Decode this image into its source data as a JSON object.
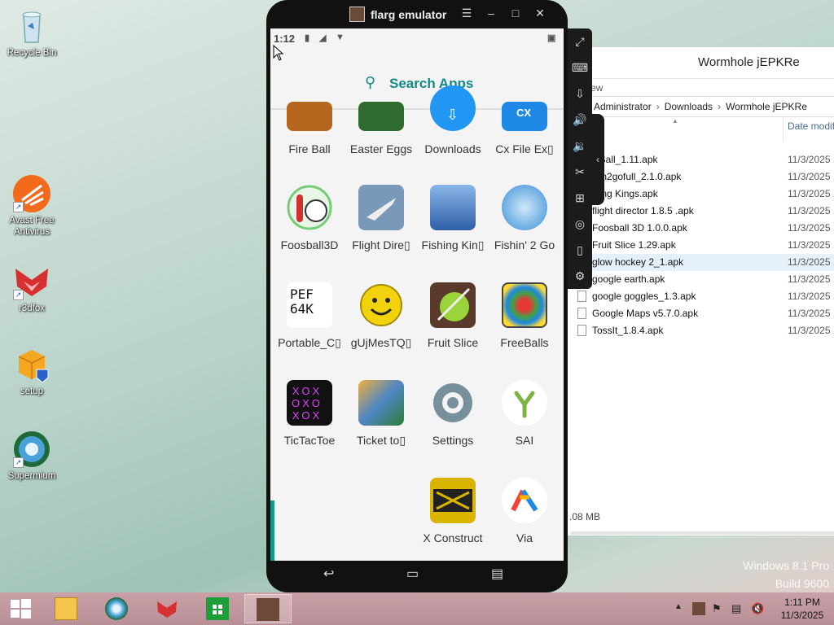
{
  "desktop": {
    "icons": [
      {
        "label": "Recycle Bin"
      },
      {
        "label": "Avast Free Antivirus"
      },
      {
        "label": "r3dfox"
      },
      {
        "label": "setup"
      },
      {
        "label": "Supermium"
      }
    ]
  },
  "explorer": {
    "title": "Wormhole jEPKRe",
    "ribbon_text": "ew",
    "breadcrumb": [
      "Administrator",
      "Downloads",
      "Wormhole jEPKRe"
    ],
    "column_date": "Date modif",
    "files": [
      {
        "name": "eBall_1.11.apk",
        "date": "11/3/2025 1"
      },
      {
        "name": "ain2gofull_2.1.0.apk",
        "date": "11/3/2025 1"
      },
      {
        "name": "hing Kings.apk",
        "date": "11/3/2025 1"
      },
      {
        "name": "flight director 1.8.5 .apk",
        "date": "11/3/2025 1"
      },
      {
        "name": "Foosball 3D 1.0.0.apk",
        "date": "11/3/2025 1"
      },
      {
        "name": "Fruit Slice 1.29.apk",
        "date": "11/3/2025 1"
      },
      {
        "name": "glow hockey 2_1.apk",
        "date": "11/3/2025 1"
      },
      {
        "name": "google earth.apk",
        "date": "11/3/2025 1"
      },
      {
        "name": "google goggles_1.3.apk",
        "date": "11/3/2025 1"
      },
      {
        "name": "Google Maps v5.7.0.apk",
        "date": "11/3/2025 1"
      },
      {
        "name": "TossIt_1.8.4.apk",
        "date": "11/3/2025 1"
      }
    ],
    "status": ".08 MB"
  },
  "emulator": {
    "title": "flarg emulator",
    "status_time": "1:12",
    "search_label": "Search Apps",
    "apps": [
      {
        "label": "Fire Ball",
        "color": "#b5651d"
      },
      {
        "label": "Easter Eggs",
        "color": "#2f6a2f"
      },
      {
        "label": "Downloads",
        "color": "#2196f3"
      },
      {
        "label": "Cx File Ex▯",
        "color": "#1e88e5"
      },
      {
        "label": "Foosball3D",
        "color": "#ffffff"
      },
      {
        "label": "Flight Dire▯",
        "color": "#7a98b8"
      },
      {
        "label": "Fishing Kin▯",
        "color": "#4a7fc8"
      },
      {
        "label": "Fishin' 2 Go",
        "color": "#3b8fd6"
      },
      {
        "label": "Portable_C▯",
        "color": "#ffffff"
      },
      {
        "label": "gUjMesTQ▯",
        "color": "#f2d20c"
      },
      {
        "label": "Fruit Slice",
        "color": "#5a8a2a"
      },
      {
        "label": "FreeBalls",
        "color": "#444444"
      },
      {
        "label": "TicTacToe",
        "color": "#111111"
      },
      {
        "label": "Ticket to▯",
        "color": "#4d86c4"
      },
      {
        "label": "Settings",
        "color": "#78909c"
      },
      {
        "label": "SAI",
        "color": "#ffffff"
      },
      {
        "label": "X Construct",
        "color": "#d9b400"
      },
      {
        "label": "Via",
        "color": "#ffffff"
      }
    ]
  },
  "taskbar": {
    "clock_time": "1:11 PM",
    "clock_date": "11/3/2025"
  },
  "watermark": {
    "line1": "Windows 8.1 Pro",
    "line2": "Build 9600"
  }
}
